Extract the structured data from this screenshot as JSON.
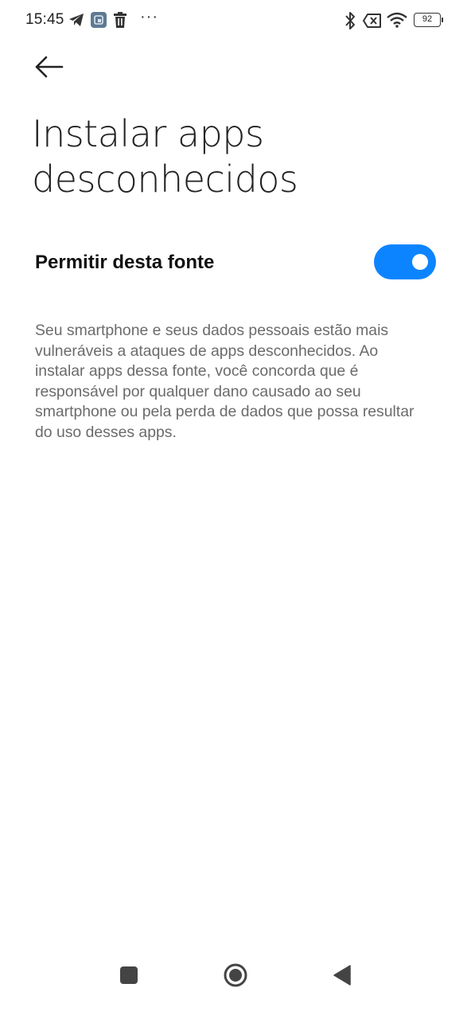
{
  "status_bar": {
    "time": "15:45",
    "more": "···",
    "battery_level": "92",
    "icons": [
      "telegram-icon",
      "app-notification-icon",
      "trash-icon",
      "bluetooth-icon",
      "no-sim-icon",
      "wifi-icon",
      "battery-icon"
    ]
  },
  "header": {
    "back_icon": "arrow-left-icon"
  },
  "page": {
    "title": "Instalar apps desconhecidos"
  },
  "setting": {
    "label": "Permitir desta fonte",
    "enabled": true,
    "toggle_color": "#0d84ff"
  },
  "description": "Seu smartphone e seus dados pessoais estão mais vulneráveis a ataques de apps desconhecidos. Ao instalar apps dessa fonte, você concorda que é responsável por qualquer dano causado ao seu smartphone ou pela perda de dados que possa resultar do uso desses apps.",
  "nav_bar": {
    "icons": [
      "recents-square-icon",
      "home-circle-icon",
      "back-triangle-icon"
    ]
  }
}
